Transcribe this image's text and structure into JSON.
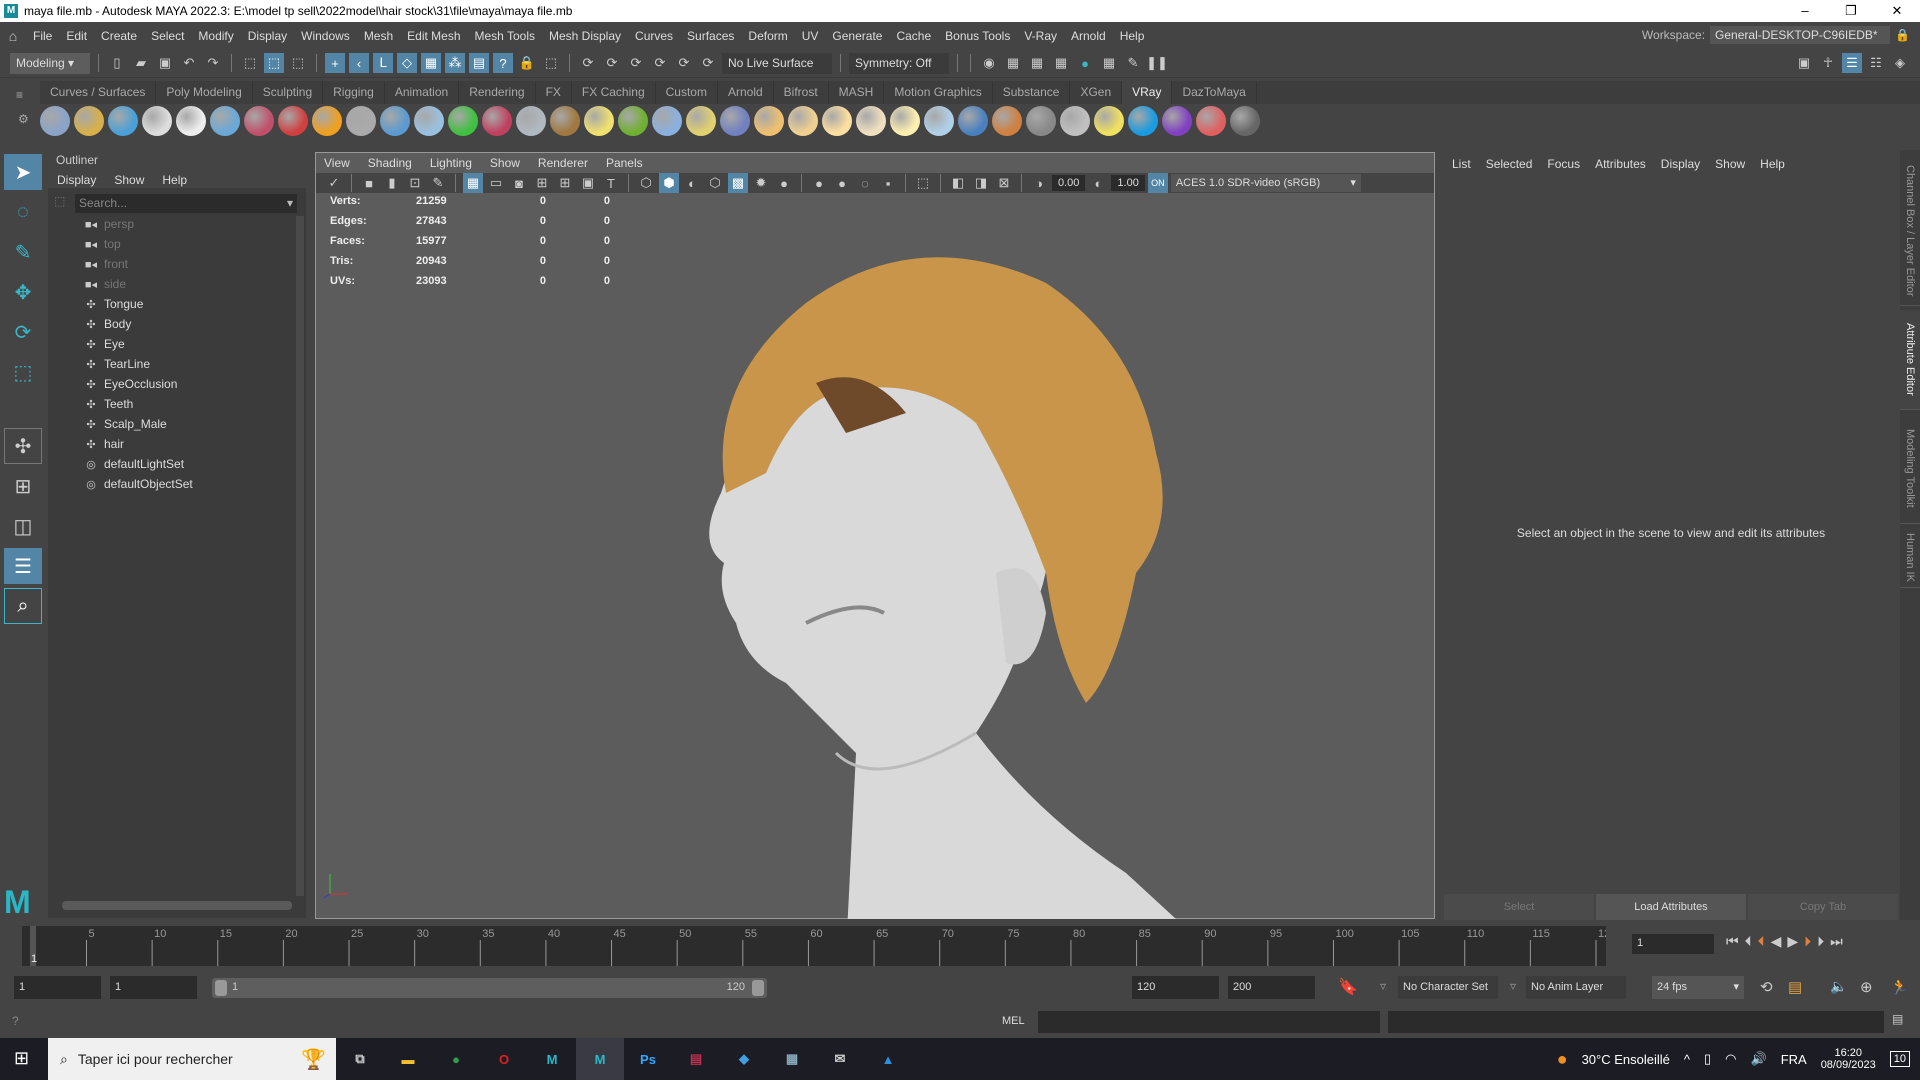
{
  "title": "maya file.mb - Autodesk MAYA 2022.3: E:\\model tp sell\\2022model\\hair stock\\31\\file\\maya\\maya file.mb",
  "menus": [
    "File",
    "Edit",
    "Create",
    "Select",
    "Modify",
    "Display",
    "Windows",
    "Mesh",
    "Edit Mesh",
    "Mesh Tools",
    "Mesh Display",
    "Curves",
    "Surfaces",
    "Deform",
    "UV",
    "Generate",
    "Cache",
    "Bonus Tools",
    "V-Ray",
    "Arnold",
    "Help"
  ],
  "workspace": {
    "label": "Workspace:",
    "value": "General-DESKTOP-C96IEDB*"
  },
  "statusline": {
    "mode": "Modeling",
    "live_surface": "No Live Surface",
    "symmetry": "Symmetry: Off"
  },
  "shelf_tabs": [
    "Curves / Surfaces",
    "Poly Modeling",
    "Sculpting",
    "Rigging",
    "Animation",
    "Rendering",
    "FX",
    "FX Caching",
    "Custom",
    "Arnold",
    "Bifrost",
    "MASH",
    "Motion Graphics",
    "Substance",
    "XGen",
    "VRay",
    "DazToMaya"
  ],
  "shelf_active": "VRay",
  "shelf_icons": [
    {
      "name": "vray-export-icon",
      "color": "#8aa4c8"
    },
    {
      "name": "vray-proxy-icon",
      "color": "#d8b04a"
    },
    {
      "name": "vray-hierarchy-icon",
      "color": "#4aa0d8"
    },
    {
      "name": "vray-plug-icon",
      "color": "#ddd"
    },
    {
      "name": "vray-doc-icon",
      "color": "#eee"
    },
    {
      "name": "vray-sphere-icon",
      "color": "#6aa8d8"
    },
    {
      "name": "vray-camera-icon",
      "color": "#c0506a"
    },
    {
      "name": "vray-molecule-icon",
      "color": "#d04040"
    },
    {
      "name": "vray-fire-icon",
      "color": "#f0a020"
    },
    {
      "name": "vray-lattice-icon",
      "color": "#aaa"
    },
    {
      "name": "vray-cube-icon",
      "color": "#5a9ad0"
    },
    {
      "name": "vray-cone-icon",
      "color": "#9ac0e0"
    },
    {
      "name": "vray-green-icon",
      "color": "#40c040"
    },
    {
      "name": "vray-bug-icon",
      "color": "#c04060"
    },
    {
      "name": "vray-mtl-icon",
      "color": "#b0b8c0"
    },
    {
      "name": "vray-texture-icon",
      "color": "#a07840"
    },
    {
      "name": "vray-globe-icon",
      "color": "#f0e070"
    },
    {
      "name": "vray-grass-icon",
      "color": "#70b030"
    },
    {
      "name": "vray-snow-icon",
      "color": "#8ab0e0"
    },
    {
      "name": "vray-hair-icon",
      "color": "#e0d070"
    },
    {
      "name": "vray-blue-sphere-icon",
      "color": "#7080c0"
    },
    {
      "name": "vray-dome-icon",
      "color": "#f0c070"
    },
    {
      "name": "vray-spot-icon",
      "color": "#f0d090"
    },
    {
      "name": "vray-light-sphere-icon",
      "color": "#ffe0a0"
    },
    {
      "name": "vray-ies-icon",
      "color": "#f0e0c0"
    },
    {
      "name": "vray-sun-icon",
      "color": "#fff0b0"
    },
    {
      "name": "vray-plane-icon",
      "color": "#b0d0e8"
    },
    {
      "name": "vray-ball-icon",
      "color": "#4a80c0"
    },
    {
      "name": "vray-flag-icon",
      "color": "#d08040"
    },
    {
      "name": "vray-checker-icon",
      "color": "#888"
    },
    {
      "name": "vray-vfb-icon",
      "color": "#c0c0c0"
    },
    {
      "name": "vray-bulb-icon",
      "color": "#f0e060"
    },
    {
      "name": "vray-cloud-icon",
      "color": "#1a9ae0"
    },
    {
      "name": "vray-chaos-icon",
      "color": "#8040c0"
    },
    {
      "name": "vray-palette-icon",
      "color": "#e06060"
    },
    {
      "name": "help-icon",
      "color": "#666"
    }
  ],
  "outliner": {
    "title": "Outliner",
    "menu": [
      "Display",
      "Show",
      "Help"
    ],
    "search_placeholder": "Search...",
    "items": [
      {
        "label": "persp",
        "type": "camera"
      },
      {
        "label": "top",
        "type": "camera"
      },
      {
        "label": "front",
        "type": "camera"
      },
      {
        "label": "side",
        "type": "camera"
      },
      {
        "label": "Tongue",
        "type": "mesh"
      },
      {
        "label": "Body",
        "type": "mesh"
      },
      {
        "label": "Eye",
        "type": "mesh"
      },
      {
        "label": "TearLine",
        "type": "mesh"
      },
      {
        "label": "EyeOcclusion",
        "type": "mesh"
      },
      {
        "label": "Teeth",
        "type": "mesh"
      },
      {
        "label": "Scalp_Male",
        "type": "mesh"
      },
      {
        "label": "hair",
        "type": "mesh"
      },
      {
        "label": "defaultLightSet",
        "type": "set"
      },
      {
        "label": "defaultObjectSet",
        "type": "set"
      }
    ]
  },
  "viewport": {
    "menu": [
      "View",
      "Shading",
      "Lighting",
      "Show",
      "Renderer",
      "Panels"
    ],
    "exposure": "0.00",
    "gamma": "1.00",
    "color_space": "ACES 1.0 SDR-video (sRGB)",
    "stats": [
      [
        "Verts:",
        "21259",
        "0",
        "0"
      ],
      [
        "Edges:",
        "27843",
        "0",
        "0"
      ],
      [
        "Faces:",
        "15977",
        "0",
        "0"
      ],
      [
        "Tris:",
        "20943",
        "0",
        "0"
      ],
      [
        "UVs:",
        "23093",
        "0",
        "0"
      ]
    ]
  },
  "attribute_editor": {
    "menu": [
      "List",
      "Selected",
      "Focus",
      "Attributes",
      "Display",
      "Show",
      "Help"
    ],
    "message": "Select an object in the scene to view and edit its attributes",
    "buttons": [
      "Select",
      "Load Attributes",
      "Copy Tab"
    ]
  },
  "side_tabs": [
    "Channel Box / Layer Editor",
    "Attribute Editor",
    "Modeling Toolkit",
    "Human IK"
  ],
  "timeline": {
    "start": 1,
    "end": 120,
    "current": 1,
    "current_label": "1",
    "current_field": "1"
  },
  "range": {
    "anim_start": "1",
    "play_start": "1",
    "slider_start": "1",
    "slider_end": "120",
    "play_end": "120",
    "anim_end": "200",
    "character_set": "No Character Set",
    "anim_layer": "No Anim Layer",
    "fps": "24 fps"
  },
  "command": {
    "lang": "MEL"
  },
  "taskbar": {
    "search_placeholder": "Taper ici pour rechercher",
    "weather": "30°C  Ensoleillé",
    "lang": "FRA",
    "time": "16:20",
    "date": "08/09/2023",
    "notif_count": "10",
    "apps": [
      {
        "name": "file-explorer-icon",
        "glyph": "▬",
        "color": "#f0c030"
      },
      {
        "name": "chrome-icon",
        "glyph": "●",
        "color": "#30a050"
      },
      {
        "name": "opera-icon",
        "glyph": "O",
        "color": "#e02020"
      },
      {
        "name": "maya-icon",
        "glyph": "M",
        "color": "#2ab8c8"
      },
      {
        "name": "maya-active-icon",
        "glyph": "M",
        "color": "#2ab8c8"
      },
      {
        "name": "photoshop-icon",
        "glyph": "Ps",
        "color": "#31a8ff"
      },
      {
        "name": "winrar-icon",
        "glyph": "▤",
        "color": "#c03050"
      },
      {
        "name": "app-icon",
        "glyph": "◆",
        "color": "#40a0e0"
      },
      {
        "name": "calculator-icon",
        "glyph": "▦",
        "color": "#8ab"
      },
      {
        "name": "mail-icon",
        "glyph": "✉",
        "color": "#ccc"
      },
      {
        "name": "photos-icon",
        "glyph": "▲",
        "color": "#2a90e0"
      }
    ]
  }
}
